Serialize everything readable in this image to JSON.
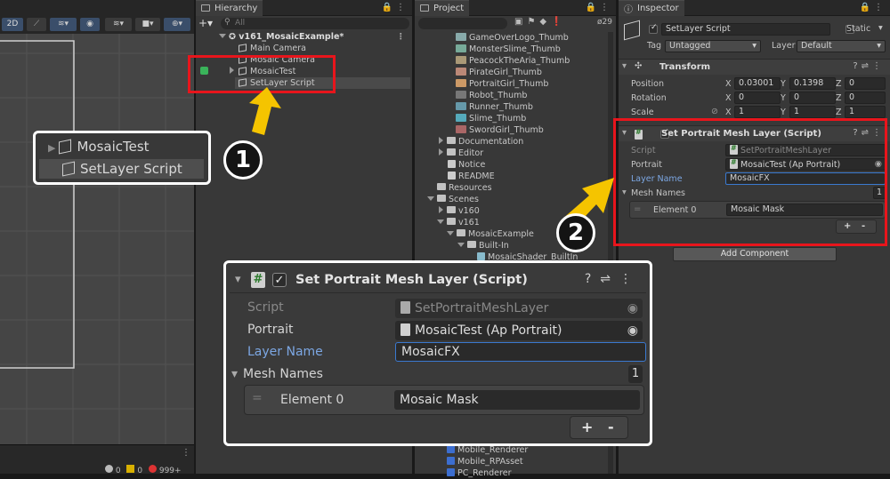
{
  "scene": {
    "toolbar": {
      "btn_2d": "2D"
    },
    "status": {
      "c1": "0",
      "c2": "0",
      "c3": "999+"
    }
  },
  "hierarchy": {
    "tab": "Hierarchy",
    "search_placeholder": "All",
    "scene_name": "v161_MosaicExample*",
    "items": [
      "Main Camera",
      "Mosaic Camera",
      "MosaicTest",
      "SetLayer Script"
    ]
  },
  "project": {
    "tab": "Project",
    "count": "29",
    "items": [
      "GameOverLogo_Thumb",
      "MonsterSlime_Thumb",
      "PeacockTheAria_Thumb",
      "PirateGirl_Thumb",
      "PortraitGirl_Thumb",
      "Robot_Thumb",
      "Runner_Thumb",
      "Slime_Thumb",
      "SwordGirl_Thumb",
      "Documentation",
      "Editor",
      "Notice",
      "README",
      "Resources",
      "Scenes",
      "v160",
      "v161",
      "MosaicExample",
      "Built-In",
      "MosaicShader_BuiltIn"
    ],
    "bottom_items": [
      "Mobile_Renderer",
      "Mobile_RPAsset",
      "PC_Renderer"
    ]
  },
  "inspector": {
    "tab": "Inspector",
    "object_name": "SetLayer Script",
    "static_label": "Static",
    "tag_label": "Tag",
    "tag_value": "Untagged",
    "layer_label": "Layer",
    "layer_value": "Default",
    "transform": {
      "title": "Transform",
      "position_label": "Position",
      "rotation_label": "Rotation",
      "scale_label": "Scale",
      "axis_x": "X",
      "axis_y": "Y",
      "axis_z": "Z",
      "position": [
        "0.03001",
        "0.1398",
        "0"
      ],
      "rotation": [
        "0",
        "0",
        "0"
      ],
      "scale": [
        "1",
        "1",
        "1"
      ]
    },
    "component": {
      "title": "Set Portrait Mesh Layer (Script)",
      "script_label": "Script",
      "script_value": "SetPortraitMeshLayer",
      "portrait_label": "Portrait",
      "portrait_value": "MosaicTest (Ap Portrait)",
      "layer_name_label": "Layer Name",
      "layer_name_value": "MosaicFX",
      "mesh_names_label": "Mesh Names",
      "mesh_names_count": "1",
      "element0_label": "Element 0",
      "element0_value": "Mosaic Mask",
      "plus": "+",
      "minus": "-"
    },
    "add_component": "Add Component"
  },
  "callouts": {
    "hier_zoom": [
      "MosaicTest",
      "SetLayer Script"
    ],
    "n1": "1",
    "n2": "2"
  },
  "colors": {
    "red": "#e8151c",
    "arrow": "#f5c400",
    "accent_blue": "#7ca7e3"
  }
}
